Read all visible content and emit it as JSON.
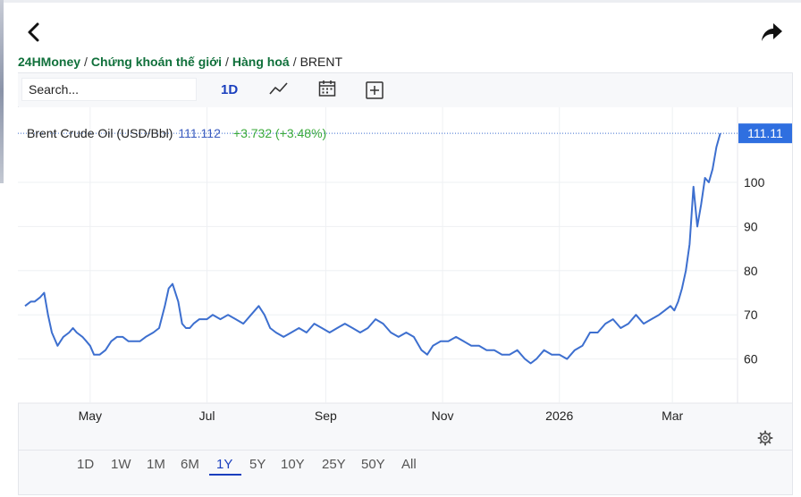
{
  "nav": {
    "back_icon": "chevron-left-icon",
    "share_icon": "share-arrow-icon"
  },
  "breadcrumb": {
    "items": [
      "24HMoney",
      "Chứng khoán thế giới",
      "Hàng hoá"
    ],
    "current": "BRENT",
    "separator": "/"
  },
  "toolbar": {
    "search_placeholder": "Search...",
    "interval": "1D",
    "icons": [
      "line-chart-icon",
      "calendar-icon",
      "add-compare-icon"
    ]
  },
  "range_buttons": [
    "1D",
    "1W",
    "1M",
    "6M",
    "1Y",
    "5Y",
    "10Y",
    "25Y",
    "50Y",
    "All"
  ],
  "active_range": "1Y",
  "colors": {
    "accent": "#1a3fbe",
    "line": "#3d6fcf",
    "up": "#3aaa3a",
    "brand_green": "#10703b",
    "price_tag": "#2f6fe0"
  },
  "chart_data": {
    "type": "line",
    "legend": {
      "name": "Brent Crude Oil (USD/Bbl)",
      "price": "111.112",
      "change": "+3.732 (+3.48%)"
    },
    "last_value_label": "111.11",
    "y_ticks": [
      60,
      70,
      80,
      90,
      100
    ],
    "x_ticks": [
      "May",
      "Jul",
      "Sep",
      "Nov",
      "2026",
      "Mar"
    ],
    "x_tick_dates": [
      "2025-05-01",
      "2025-07-01",
      "2025-09-01",
      "2025-11-01",
      "2026-01-01",
      "2026-03-01"
    ],
    "ylim": [
      50,
      117
    ],
    "xlim": [
      "2025-03-28",
      "2026-03-28"
    ],
    "grid": true,
    "series": [
      {
        "x": [
          "2025-03-28",
          "2025-03-31",
          "2025-04-02",
          "2025-04-05",
          "2025-04-07",
          "2025-04-09",
          "2025-04-11",
          "2025-04-14",
          "2025-04-17",
          "2025-04-20",
          "2025-04-22",
          "2025-04-24",
          "2025-04-27",
          "2025-04-29",
          "2025-05-01",
          "2025-05-03",
          "2025-05-06",
          "2025-05-09",
          "2025-05-12",
          "2025-05-15",
          "2025-05-18",
          "2025-05-21",
          "2025-05-24",
          "2025-05-27",
          "2025-05-30",
          "2025-06-03",
          "2025-06-06",
          "2025-06-09",
          "2025-06-11",
          "2025-06-13",
          "2025-06-16",
          "2025-06-18",
          "2025-06-20",
          "2025-06-22",
          "2025-06-24",
          "2025-06-27",
          "2025-07-01",
          "2025-07-04",
          "2025-07-08",
          "2025-07-12",
          "2025-07-16",
          "2025-07-20",
          "2025-07-24",
          "2025-07-28",
          "2025-07-31",
          "2025-08-03",
          "2025-08-06",
          "2025-08-10",
          "2025-08-14",
          "2025-08-18",
          "2025-08-22",
          "2025-08-26",
          "2025-08-30",
          "2025-09-03",
          "2025-09-07",
          "2025-09-11",
          "2025-09-15",
          "2025-09-19",
          "2025-09-23",
          "2025-09-27",
          "2025-10-01",
          "2025-10-05",
          "2025-10-09",
          "2025-10-13",
          "2025-10-17",
          "2025-10-21",
          "2025-10-24",
          "2025-10-27",
          "2025-10-31",
          "2025-11-04",
          "2025-11-08",
          "2025-11-12",
          "2025-11-16",
          "2025-11-20",
          "2025-11-24",
          "2025-11-28",
          "2025-12-02",
          "2025-12-06",
          "2025-12-10",
          "2025-12-14",
          "2025-12-17",
          "2025-12-20",
          "2025-12-24",
          "2025-12-28",
          "2026-01-01",
          "2026-01-05",
          "2026-01-09",
          "2026-01-13",
          "2026-01-17",
          "2026-01-21",
          "2026-01-25",
          "2026-01-29",
          "2026-02-02",
          "2026-02-06",
          "2026-02-10",
          "2026-02-14",
          "2026-02-18",
          "2026-02-22",
          "2026-02-25",
          "2026-02-28",
          "2026-03-02",
          "2026-03-04",
          "2026-03-06",
          "2026-03-08",
          "2026-03-10",
          "2026-03-12",
          "2026-03-14",
          "2026-03-16",
          "2026-03-18",
          "2026-03-20",
          "2026-03-22",
          "2026-03-24",
          "2026-03-26"
        ],
        "y": [
          72,
          73,
          73,
          74,
          75,
          70,
          66,
          63,
          65,
          66,
          67,
          66,
          65,
          64,
          63,
          61,
          61,
          62,
          64,
          65,
          65,
          64,
          64,
          64,
          65,
          66,
          67,
          72,
          76,
          77,
          73,
          68,
          67,
          67,
          68,
          69,
          69,
          70,
          69,
          70,
          69,
          68,
          70,
          72,
          70,
          67,
          66,
          65,
          66,
          67,
          66,
          68,
          67,
          66,
          67,
          68,
          67,
          66,
          67,
          69,
          68,
          66,
          65,
          66,
          65,
          62,
          61,
          63,
          64,
          64,
          65,
          64,
          63,
          63,
          62,
          62,
          61,
          61,
          62,
          60,
          59,
          60,
          62,
          61,
          61,
          60,
          62,
          63,
          66,
          66,
          68,
          69,
          67,
          68,
          70,
          68,
          69,
          70,
          71,
          72,
          71,
          73,
          76,
          80,
          86,
          99,
          90,
          95,
          101,
          100,
          103,
          108,
          111.1
        ]
      }
    ]
  }
}
